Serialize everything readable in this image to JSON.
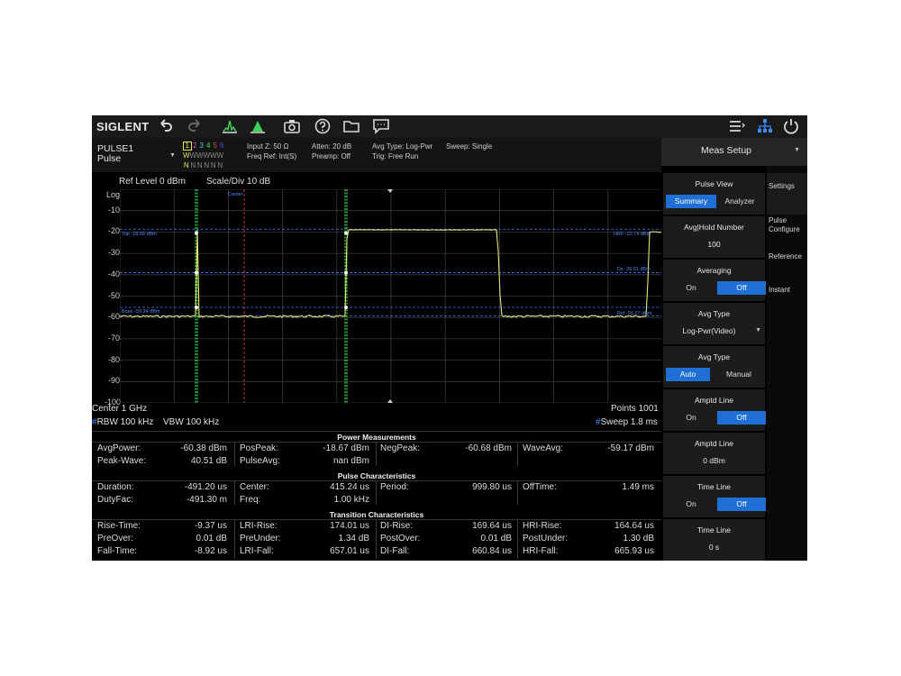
{
  "toolbar": {
    "logo": "SIGLENT",
    "icons": [
      "undo-icon",
      "redo-icon",
      "marker-peak-icon",
      "marker-save-icon",
      "camera-icon",
      "help-icon",
      "folder-icon",
      "message-icon",
      "menu-list-icon",
      "network-icon",
      "power-icon"
    ]
  },
  "status": {
    "meas_name": "PULSE1",
    "meas_mode": "Pulse",
    "trace_nums": [
      "1",
      "2",
      "3",
      "4",
      "5",
      "6"
    ],
    "trace_colors": [
      "#e8e84a",
      "#e04aa0",
      "#4ac8e0",
      "#4ae04a",
      "#e0504a",
      "#4a4ae0"
    ],
    "trace_modes": [
      "W",
      "W",
      "W",
      "W",
      "W",
      "W"
    ],
    "trace_det": [
      "N",
      "N",
      "N",
      "N",
      "N",
      "N"
    ],
    "input_z": "Input Z: 50 Ω",
    "freq_ref": "Freq Ref: Int(S)",
    "atten": "Atten: 20 dB",
    "preamp": "Preamp: Off",
    "avg_type": "Avg Type: Log-Pwr",
    "trig": "Trig: Free Run",
    "sweep": "Sweep: Single"
  },
  "plot": {
    "ref_level": "Ref Level  0 dBm",
    "scale_div": "Scale/Div  10 dB",
    "log_label": "Log",
    "y_ticks": [
      "-10",
      "-20",
      "-30",
      "-40",
      "-50",
      "-60",
      "-70",
      "-80",
      "-90",
      "-100"
    ],
    "center_tag": "Center",
    "center_freq": "Center  1 GHz",
    "points": "Points  1001",
    "rbw": "RBW  100 kHz",
    "vbw": "VBW  100 kHz",
    "sweep_time": "Sweep  1.8 ms",
    "marker_labels": {
      "top": "Top -18.68 dBm",
      "base": "Base -59.34 dBm",
      "hrf": "HRF -22.74 dBm",
      "mid": "Dz -39.01 dBm",
      "ref": "Ref -55.27 dBm"
    },
    "trace_color": "#e6e67a",
    "grid_color": "#3a3a3a",
    "marker_line_color": "#3c78ff",
    "center_line_color": "#ff3c50",
    "edge_line_color": "#2ee04a"
  },
  "power": {
    "title": "Power Measurements",
    "rows": [
      [
        "AvgPower:",
        "-60.38 dBm",
        "PosPeak:",
        "-18.67 dBm",
        "NegPeak:",
        "-60.68 dBm",
        "WaveAvg:",
        "-59.17 dBm"
      ],
      [
        "Peak-Wave:",
        "40.51 dB",
        "PulseAvg:",
        "nan dBm",
        "",
        "",
        "",
        ""
      ]
    ]
  },
  "pulse": {
    "title": "Pulse Characteristics",
    "rows": [
      [
        "Duration:",
        "-491.20 us",
        "Center:",
        "415.24 us",
        "Period:",
        "999.80 us",
        "OffTime:",
        "1.49 ms"
      ],
      [
        "DutyFac:",
        "-491.30 m",
        "Freq:",
        "1.00 kHz",
        "",
        "",
        "",
        ""
      ]
    ]
  },
  "transition": {
    "title": "Transition Characteristics",
    "rows": [
      [
        "Rise-Time:",
        "-9.37 us",
        "LRI-Rise:",
        "174.01 us",
        "DI-Rise:",
        "169.64 us",
        "HRI-Rise:",
        "164.64 us"
      ],
      [
        "PreOver:",
        "0.01 dB",
        "PreUnder:",
        "1.34 dB",
        "PostOver:",
        "0.01 dB",
        "PostUnder:",
        "1.30 dB"
      ],
      [
        "Fall-Time:",
        "-8.92 us",
        "LRI-Fall:",
        "657.01 us",
        "DI-Fall:",
        "660.84 us",
        "HRI-Fall:",
        "665.93 us"
      ]
    ]
  },
  "side": {
    "title": "Meas Setup",
    "pulse_view": {
      "label": "Pulse View",
      "opt1": "Summary",
      "opt2": "Analyzer",
      "selected": "Summary"
    },
    "avg_hold": {
      "label": "Avg|Hold Number",
      "value": "100"
    },
    "averaging": {
      "label": "Averaging",
      "opt1": "On",
      "opt2": "Off",
      "selected": "Off"
    },
    "avg_type1": {
      "label": "Avg Type",
      "value": "Log-Pwr(Video)"
    },
    "avg_type2": {
      "label": "Avg Type",
      "opt1": "Auto",
      "opt2": "Manual",
      "selected": "Auto"
    },
    "ampt_line": {
      "label": "Amptd Line",
      "opt1": "On",
      "opt2": "Off",
      "selected": "Off"
    },
    "ampt_line_val": {
      "label": "Amptd Line",
      "value": "0 dBm"
    },
    "time_line": {
      "label": "Time Line",
      "opt1": "On",
      "opt2": "Off",
      "selected": "Off"
    },
    "time_line_val": {
      "label": "Time Line",
      "value": "0 s"
    }
  },
  "tabs": [
    "Settings",
    "Pulse Configure",
    "Reference",
    "Instant"
  ]
}
